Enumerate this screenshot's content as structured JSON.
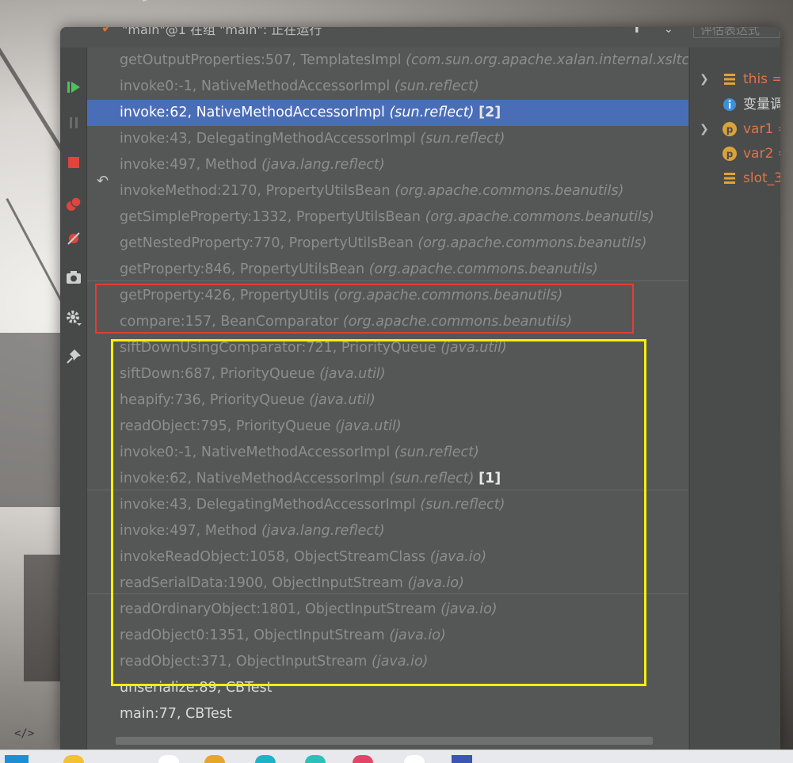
{
  "window": {
    "title": "\"main\"@1 在组 \"main\": 正在运行",
    "eval_placeholder": "评估表达式"
  },
  "frames": [
    {
      "method": "getOutputProperties:507, TemplatesImpl",
      "pkg": "(com.sun.org.apache.xalan.internal.xsltc.trax)",
      "tag": "",
      "style": "dim"
    },
    {
      "method": "invoke0:-1, NativeMethodAccessorImpl",
      "pkg": "(sun.reflect)",
      "tag": "",
      "style": "dim"
    },
    {
      "method": "invoke:62, NativeMethodAccessorImpl",
      "pkg": "(sun.reflect)",
      "tag": "[2]",
      "style": "selected"
    },
    {
      "method": "invoke:43, DelegatingMethodAccessorImpl",
      "pkg": "(sun.reflect)",
      "tag": "",
      "style": "dim"
    },
    {
      "method": "invoke:497, Method",
      "pkg": "(java.lang.reflect)",
      "tag": "",
      "style": "dim"
    },
    {
      "method": "invokeMethod:2170, PropertyUtilsBean",
      "pkg": "(org.apache.commons.beanutils)",
      "tag": "",
      "style": "dim"
    },
    {
      "method": "getSimpleProperty:1332, PropertyUtilsBean",
      "pkg": "(org.apache.commons.beanutils)",
      "tag": "",
      "style": "dim"
    },
    {
      "method": "getNestedProperty:770, PropertyUtilsBean",
      "pkg": "(org.apache.commons.beanutils)",
      "tag": "",
      "style": "dim"
    },
    {
      "method": "getProperty:846, PropertyUtilsBean",
      "pkg": "(org.apache.commons.beanutils)",
      "tag": "",
      "style": "dim"
    },
    {
      "method": "getProperty:426, PropertyUtils",
      "pkg": "(org.apache.commons.beanutils)",
      "tag": "",
      "style": "dim"
    },
    {
      "method": "compare:157, BeanComparator",
      "pkg": "(org.apache.commons.beanutils)",
      "tag": "",
      "style": "dim"
    },
    {
      "method": "siftDownUsingComparator:721, PriorityQueue",
      "pkg": "(java.util)",
      "tag": "",
      "style": "dim"
    },
    {
      "method": "siftDown:687, PriorityQueue",
      "pkg": "(java.util)",
      "tag": "",
      "style": "dim"
    },
    {
      "method": "heapify:736, PriorityQueue",
      "pkg": "(java.util)",
      "tag": "",
      "style": "dim"
    },
    {
      "method": "readObject:795, PriorityQueue",
      "pkg": "(java.util)",
      "tag": "",
      "style": "dim"
    },
    {
      "method": "invoke0:-1, NativeMethodAccessorImpl",
      "pkg": "(sun.reflect)",
      "tag": "",
      "style": "dim"
    },
    {
      "method": "invoke:62, NativeMethodAccessorImpl",
      "pkg": "(sun.reflect)",
      "tag": "[1]",
      "style": "dim"
    },
    {
      "method": "invoke:43, DelegatingMethodAccessorImpl",
      "pkg": "(sun.reflect)",
      "tag": "",
      "style": "dim"
    },
    {
      "method": "invoke:497, Method",
      "pkg": "(java.lang.reflect)",
      "tag": "",
      "style": "dim"
    },
    {
      "method": "invokeReadObject:1058, ObjectStreamClass",
      "pkg": "(java.io)",
      "tag": "",
      "style": "dim"
    },
    {
      "method": "readSerialData:1900, ObjectInputStream",
      "pkg": "(java.io)",
      "tag": "",
      "style": "dim"
    },
    {
      "method": "readOrdinaryObject:1801, ObjectInputStream",
      "pkg": "(java.io)",
      "tag": "",
      "style": "dim"
    },
    {
      "method": "readObject0:1351, ObjectInputStream",
      "pkg": "(java.io)",
      "tag": "",
      "style": "dim"
    },
    {
      "method": "readObject:371, ObjectInputStream",
      "pkg": "(java.io)",
      "tag": "",
      "style": "dim"
    },
    {
      "method": "unserialize:89, CBTest",
      "pkg": "",
      "tag": "",
      "style": "bright"
    },
    {
      "method": "main:77, CBTest",
      "pkg": "",
      "tag": "",
      "style": "bright"
    }
  ],
  "variables": [
    {
      "name": "this =",
      "icon": "field-icon",
      "expandable": true,
      "warn": true
    },
    {
      "name": "变量调",
      "icon": "info-icon",
      "expandable": false,
      "warn": false
    },
    {
      "name": "var1 =",
      "icon": "param-icon",
      "expandable": true,
      "warn": true
    },
    {
      "name": "var2 =",
      "icon": "param-icon",
      "expandable": false,
      "warn": true
    },
    {
      "name": "slot_3",
      "icon": "field-icon",
      "expandable": false,
      "warn": true
    }
  ],
  "toolbar": [
    "resume-icon",
    "pause-icon",
    "stop-icon",
    "view-breakpoints-icon",
    "mute-breakpoints-icon",
    "camera-icon",
    "settings-icon",
    "pin-icon"
  ],
  "colors": {
    "selection": "#4a6db8",
    "red_box": "#e33d35",
    "yellow_box": "#f4f00b",
    "resume": "#4ec15a",
    "stop": "#e0443e",
    "var_orange": "#e07448"
  },
  "footer": {
    "code_glyph": "</>"
  }
}
